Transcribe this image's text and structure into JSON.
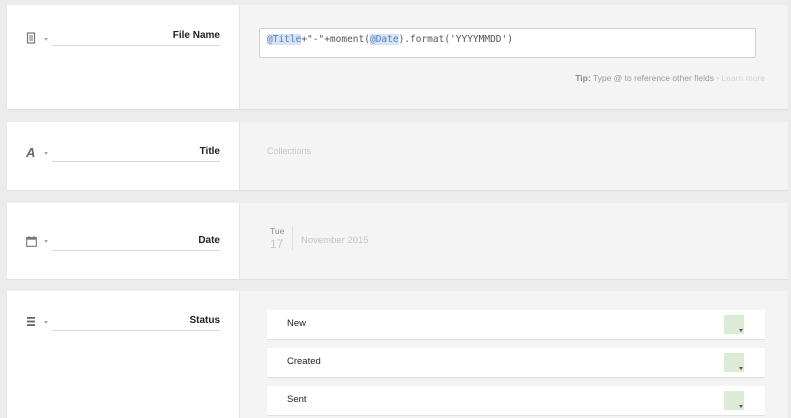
{
  "fields": {
    "file_name": {
      "label": "File Name",
      "icon": "document-icon",
      "formula": {
        "token1": "@Title",
        "part2": "+\"-\"+moment(",
        "token2": "@Date",
        "part3": ").format('YYYYMMDD')"
      },
      "tip_prefix": "Tip:",
      "tip_text": " Type @ to reference other fields · ",
      "tip_link": "Learn more"
    },
    "title": {
      "label": "Title",
      "icon": "text-icon",
      "value": "Collections"
    },
    "date": {
      "label": "Date",
      "icon": "calendar-icon",
      "weekday": "Tue",
      "day": "17",
      "month_year": "November 2015"
    },
    "status": {
      "label": "Status",
      "icon": "list-icon",
      "options": [
        {
          "label": "New",
          "color": "#dcebd6"
        },
        {
          "label": "Created",
          "color": "#dcebd6"
        },
        {
          "label": "Sent",
          "color": "#dcebd6"
        }
      ]
    }
  }
}
